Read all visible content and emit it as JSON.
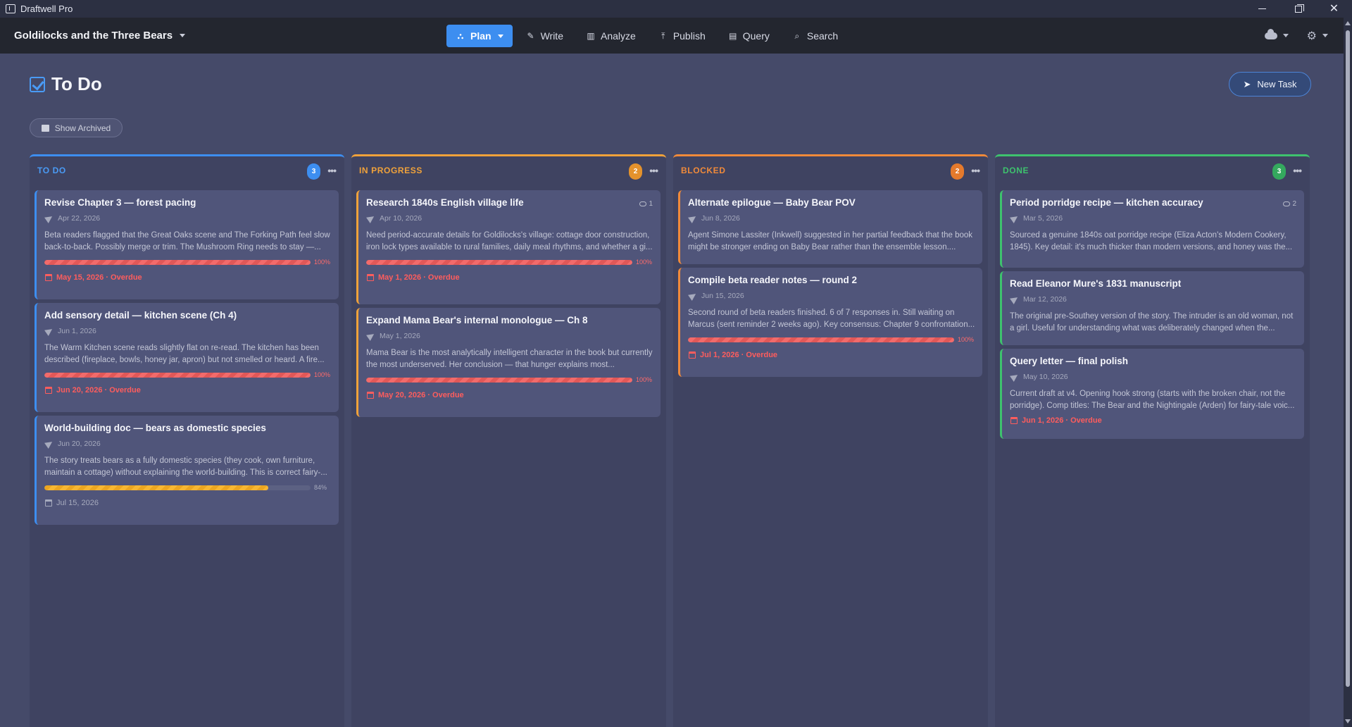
{
  "window": {
    "title": "Draftwell Pro"
  },
  "header": {
    "project_title": "Goldilocks and the Three Bears",
    "nav": [
      {
        "label": "Plan",
        "icon": "sitemap-icon",
        "active": true
      },
      {
        "label": "Write",
        "icon": "pencil-icon"
      },
      {
        "label": "Analyze",
        "icon": "bar-chart-icon"
      },
      {
        "label": "Publish",
        "icon": "upload-icon"
      },
      {
        "label": "Query",
        "icon": "table-icon"
      },
      {
        "label": "Search",
        "icon": "search-icon"
      }
    ]
  },
  "page": {
    "title": "To Do",
    "new_task_label": "New Task",
    "show_archived_label": "Show Archived"
  },
  "colors": {
    "todo": "#3d8ef0",
    "in_progress": "#f0a23a",
    "blocked": "#f08a3a",
    "done": "#3ec26e",
    "overdue": "#ff5d5d"
  },
  "columns": [
    {
      "title": "TO DO",
      "count": "3",
      "cards": [
        {
          "title": "Revise Chapter 3 — forest pacing",
          "date": "Apr 22, 2026",
          "desc": "Beta readers flagged that the Great Oaks scene and The Forking Path feel slow back-to-back. Possibly merge or trim. The Mushroom Ring needs to stay —...",
          "progress": 100,
          "progress_label": "100%",
          "due": "May 15, 2026 · Overdue",
          "overdue": true
        },
        {
          "title": "Add sensory detail — kitchen scene (Ch 4)",
          "date": "Jun 1, 2026",
          "desc": "The Warm Kitchen scene reads slightly flat on re-read. The kitchen has been described (fireplace, bowls, honey jar, apron) but not smelled or heard. A fire...",
          "progress": 100,
          "progress_label": "100%",
          "due": "Jun 20, 2026 · Overdue",
          "overdue": true
        },
        {
          "title": "World-building doc — bears as domestic species",
          "date": "Jun 20, 2026",
          "desc": "The story treats bears as a fully domestic species (they cook, own furniture, maintain a cottage) without explaining the world-building. This is correct fairy-...",
          "progress": 84,
          "progress_label": "84%",
          "due": "Jul 15, 2026",
          "overdue": false
        }
      ]
    },
    {
      "title": "IN PROGRESS",
      "count": "2",
      "cards": [
        {
          "title": "Research 1840s English village life",
          "date": "Apr 10, 2026",
          "comments": "1",
          "desc": "Need period-accurate details for Goldilocks's village: cottage door construction, iron lock types available to rural families, daily meal rhythms, and whether a gi...",
          "progress": 100,
          "progress_label": "100%",
          "due": "May 1, 2026 · Overdue",
          "overdue": true
        },
        {
          "title": "Expand Mama Bear's internal monologue — Ch 8",
          "date": "May 1, 2026",
          "desc": "Mama Bear is the most analytically intelligent character in the book but currently the most underserved. Her conclusion — that hunger explains most...",
          "progress": 100,
          "progress_label": "100%",
          "due": "May 20, 2026 · Overdue",
          "overdue": true
        }
      ]
    },
    {
      "title": "BLOCKED",
      "count": "2",
      "cards": [
        {
          "title": "Alternate epilogue — Baby Bear POV",
          "date": "Jun 8, 2026",
          "desc": "Agent Simone Lassiter (Inkwell) suggested in her partial feedback that the book might be stronger ending on Baby Bear rather than the ensemble lesson...."
        },
        {
          "title": "Compile beta reader notes — round 2",
          "date": "Jun 15, 2026",
          "desc": "Second round of beta readers finished. 6 of 7 responses in. Still waiting on Marcus (sent reminder 2 weeks ago). Key consensus: Chapter 9 confrontation...",
          "progress": 100,
          "progress_label": "100%",
          "due": "Jul 1, 2026 · Overdue",
          "overdue": true
        }
      ]
    },
    {
      "title": "DONE",
      "count": "3",
      "cards": [
        {
          "title": "Period porridge recipe — kitchen accuracy",
          "date": "Mar 5, 2026",
          "comments": "2",
          "desc": "Sourced a genuine 1840s oat porridge recipe (Eliza Acton's Modern Cookery, 1845). Key detail: it's much thicker than modern versions, and honey was the..."
        },
        {
          "title": "Read Eleanor Mure's 1831 manuscript",
          "date": "Mar 12, 2026",
          "desc": "The original pre-Southey version of the story. The intruder is an old woman, not a girl. Useful for understanding what was deliberately changed when the..."
        },
        {
          "title": "Query letter — final polish",
          "date": "May 10, 2026",
          "desc": "Current draft at v4. Opening hook strong (starts with the broken chair, not the porridge). Comp titles: The Bear and the Nightingale (Arden) for fairy-tale voic...",
          "due": "Jun 1, 2026 · Overdue",
          "overdue": true
        }
      ]
    }
  ]
}
